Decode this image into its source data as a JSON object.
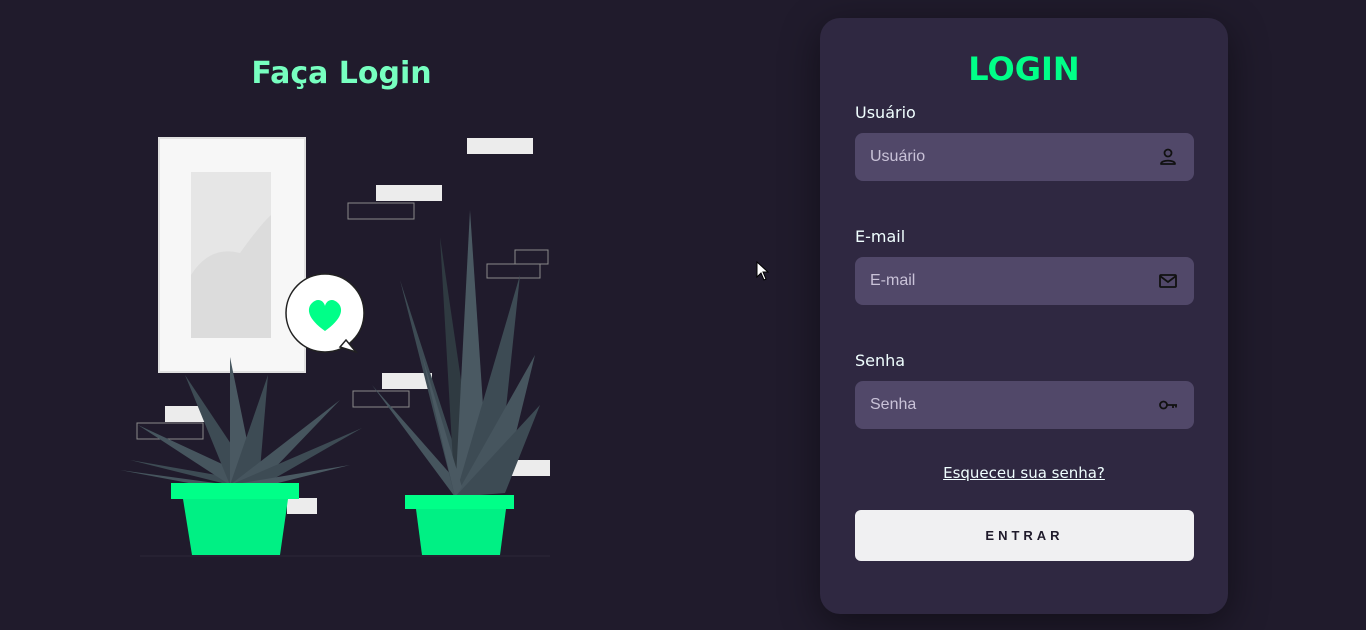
{
  "left": {
    "title": "Faça Login"
  },
  "form": {
    "title": "LOGIN",
    "fields": [
      {
        "label": "Usuário",
        "placeholder": "Usuário",
        "icon": "user-icon"
      },
      {
        "label": "E-mail",
        "placeholder": "E-mail",
        "icon": "mail-icon"
      },
      {
        "label": "Senha",
        "placeholder": "Senha",
        "icon": "key-icon"
      }
    ],
    "forgot_link": "Esqueceu sua senha?",
    "submit_label": "ENTRAR"
  },
  "colors": {
    "background": "#201b2c",
    "card": "#2f2841",
    "input": "#514869",
    "accent": "#00ff88",
    "left_title": "#77ffc0",
    "button": "#f0f0f2"
  }
}
